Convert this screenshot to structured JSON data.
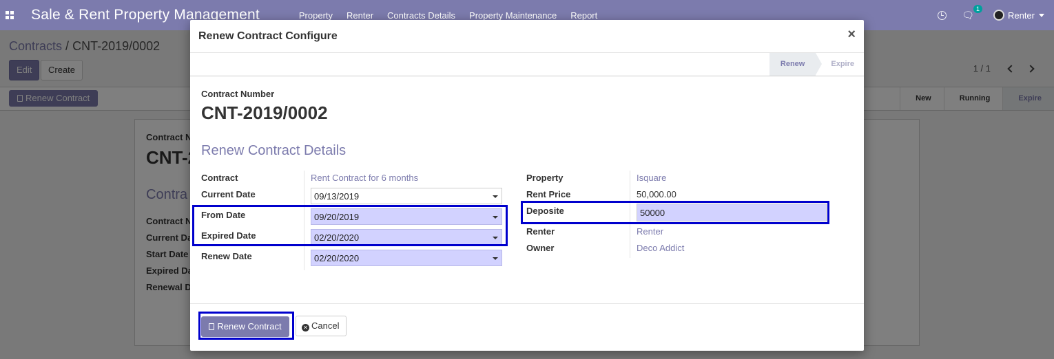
{
  "navbar": {
    "brand": "Sale & Rent Property Management",
    "menu": [
      "Property",
      "Renter",
      "Contracts Details",
      "Property Maintenance",
      "Report"
    ],
    "chat_badge": "1",
    "user": "Renter"
  },
  "control_panel": {
    "breadcrumb_parent": "Contracts",
    "breadcrumb_sep": "/",
    "breadcrumb_current": "CNT-2019/0002",
    "edit_label": "Edit",
    "create_label": "Create",
    "pager": "1 / 1",
    "renew_button": "Renew Contract",
    "stages": [
      "New",
      "Running",
      "Expire"
    ]
  },
  "background_sheet": {
    "label_contract": "Contract N",
    "number": "CNT-2",
    "section": "Contra",
    "labels": [
      "Contract N",
      "Current Da",
      "Start Date",
      "Expired Da",
      "Renewal D"
    ]
  },
  "modal": {
    "title": "Renew Contract Configure",
    "close": "×",
    "stages": {
      "active": "Renew",
      "inactive": "Expire"
    },
    "contract_number_label": "Contract Number",
    "contract_number": "CNT-2019/0002",
    "section_title": "Renew Contract Details",
    "left": {
      "contract_label": "Contract",
      "contract_value": "Rent Contract for 6 months",
      "current_date_label": "Current Date",
      "current_date": "09/13/2019",
      "from_date_label": "From Date",
      "from_date": "09/20/2019",
      "expired_date_label": "Expired Date",
      "expired_date": "02/20/2020",
      "renew_date_label": "Renew Date",
      "renew_date": "02/20/2020"
    },
    "right": {
      "property_label": "Property",
      "property_value": "Isquare",
      "rent_price_label": "Rent Price",
      "rent_price": "50,000.00",
      "deposite_label": "Deposite",
      "deposite": "50000",
      "renter_label": "Renter",
      "renter_value": "Renter",
      "owner_label": "Owner",
      "owner_value": "Deco Addict"
    },
    "footer": {
      "renew_label": "Renew Contract",
      "cancel_label": "Cancel"
    }
  },
  "colors": {
    "brand": "#7c7bad",
    "required_field": "#d2d2ff",
    "highlight": "#0000cd"
  }
}
